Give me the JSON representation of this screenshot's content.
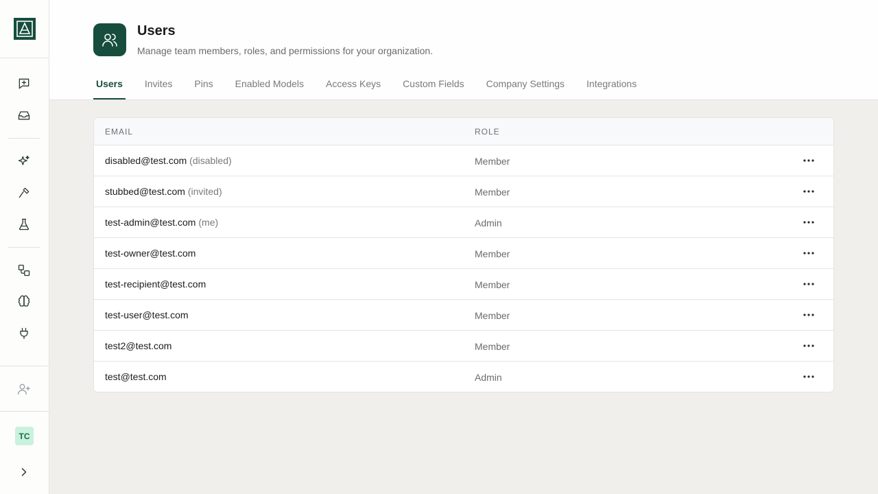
{
  "sidebar": {
    "logo": "app-logo",
    "items": [
      {
        "icon": "new-chat-icon"
      },
      {
        "icon": "inbox-icon"
      },
      {
        "icon": "sparkles-icon"
      },
      {
        "icon": "hammer-icon"
      },
      {
        "icon": "flask-icon"
      },
      {
        "icon": "workflow-icon"
      },
      {
        "icon": "brain-icon"
      },
      {
        "icon": "plug-icon"
      },
      {
        "icon": "add-user-icon"
      }
    ],
    "avatar_initials": "TC",
    "expand_icon": "chevron-right-icon"
  },
  "header": {
    "title": "Users",
    "subtitle": "Manage team members, roles, and permissions for your organization.",
    "tabs": [
      "Users",
      "Invites",
      "Pins",
      "Enabled Models",
      "Access Keys",
      "Custom Fields",
      "Company Settings",
      "Integrations"
    ],
    "active_tab": "Users"
  },
  "table": {
    "columns": [
      "EMAIL",
      "ROLE"
    ],
    "rows": [
      {
        "email": "disabled@test.com",
        "note": "(disabled)",
        "role": "Member"
      },
      {
        "email": "stubbed@test.com",
        "note": "(invited)",
        "role": "Member"
      },
      {
        "email": "test-admin@test.com",
        "note": "(me)",
        "role": "Admin"
      },
      {
        "email": "test-owner@test.com",
        "note": "",
        "role": "Member"
      },
      {
        "email": "test-recipient@test.com",
        "note": "",
        "role": "Member"
      },
      {
        "email": "test-user@test.com",
        "note": "",
        "role": "Member"
      },
      {
        "email": "test2@test.com",
        "note": "",
        "role": "Member"
      },
      {
        "email": "test@test.com",
        "note": "",
        "role": "Admin"
      }
    ]
  },
  "colors": {
    "brand": "#174d3c",
    "avatar_bg": "#c9f1de",
    "page_bg": "#f0efeb"
  }
}
